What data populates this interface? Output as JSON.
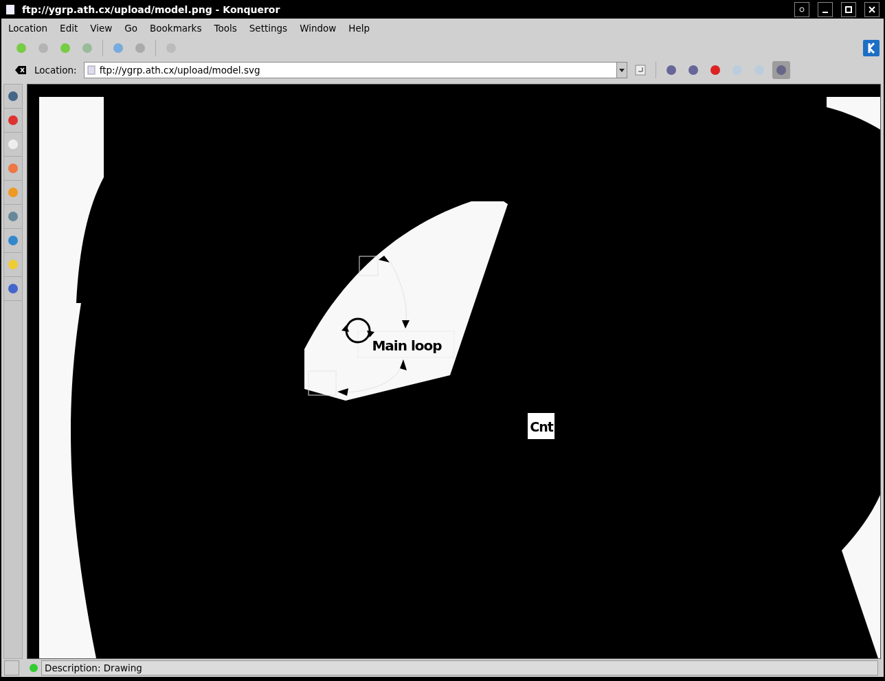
{
  "window": {
    "title": "ftp://ygrp.ath.cx/upload/model.png - Konqueror"
  },
  "menu": [
    "Location",
    "Edit",
    "View",
    "Go",
    "Bookmarks",
    "Tools",
    "Settings",
    "Window",
    "Help"
  ],
  "location": {
    "label": "Location:",
    "value": "ftp://ygrp.ath.cx/upload/model.svg"
  },
  "drawing": {
    "labels": [
      {
        "kind": "node",
        "text": "Main loop"
      },
      {
        "kind": "tag",
        "text": "Cnt"
      }
    ]
  },
  "status_bar": {
    "text": "Description: Drawing"
  }
}
